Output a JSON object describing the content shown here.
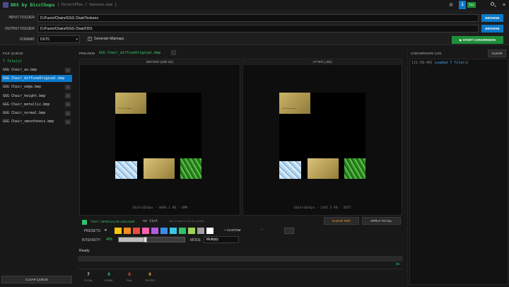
{
  "titlebar": {
    "app_title": "DDS by DiccChops",
    "subtitle": "[ DirectXTex / texconv.exe ]",
    "info_label": "i",
    "badge": "tex"
  },
  "form": {
    "input_label": "INPUT FOLDER",
    "input_value": "D:/Fuorn/Chairs/GGG Chair/Textures",
    "output_label": "OUTPUT FOLDER",
    "output_value": "D:/Fuorn/Chairs/GGG Chair/DDS",
    "format_label": "FORMAT",
    "format_value": "DXT5",
    "mipmaps_label": "Generate Mipmaps",
    "mipmaps_checked": true,
    "browse_label": "BROWSE",
    "start_label": "▶ START CONVERSION"
  },
  "queue": {
    "title": "FILE QUEUE",
    "count": "7 file(s)",
    "items": [
      {
        "name": "GGG Chair_ao.bmp"
      },
      {
        "name": "GGG Chair_diffuseOriginal.bmp"
      },
      {
        "name": "GGG Chair_edge.bmp"
      },
      {
        "name": "GGG Chair_height.bmp"
      },
      {
        "name": "GGG Chair_metallic.bmp"
      },
      {
        "name": "GGG Chair_normal.bmp"
      },
      {
        "name": "GGG Chair_smoothness.bmp"
      }
    ],
    "remove_glyph": "×",
    "clear_label": "CLEAR QUEUE"
  },
  "preview": {
    "label": "PREVIEW",
    "file": "GGG Chair_diffuseOriginal.bmp",
    "before_title": "BEFORE (with tint)",
    "after_title": "AFTER (.dds)",
    "before_info": "1024×1024px  ·  4096.1 KB  ·  BMP",
    "after_info": "1024×1024px  ·  1365.5 KB  ·  DXT5",
    "tile_caption": "GGG Chair Original"
  },
  "tint": {
    "title": "TINT / SPECULAR COLOUR",
    "no_tint": "no tint",
    "hint": "click a swatch to tint the preview",
    "clear_label": "CLEAR TINT",
    "apply_all_label": "APPLY TO ALL",
    "presets_label": "PRESETS",
    "preset_none": "✖",
    "swatches": [
      "#f5c518",
      "#f58a1e",
      "#e74c3c",
      "#ff5fb0",
      "#b05ce0",
      "#3b8de8",
      "#38c6e8",
      "#2fc26b",
      "#9ed25a",
      "#a0a0a0",
      "#ffffff"
    ],
    "custom_label": "+ CUSTOM",
    "dash": "—",
    "intensity_label": "INTENSITY",
    "intensity_value": "40%",
    "intensity": 0.4,
    "mode_label": "MODE",
    "mode_value": "Multiply",
    "pick_color": "#2d2d2d"
  },
  "status": {
    "text": "Ready",
    "progress_label": "0%",
    "progress": 0
  },
  "stats": [
    {
      "value": "7",
      "label": "TOTAL",
      "color": "#d8d8d8"
    },
    {
      "value": "0",
      "label": "DONE",
      "color": "#2fc26b"
    },
    {
      "value": "0",
      "label": "FAIL",
      "color": "#e74c3c"
    },
    {
      "value": "0",
      "label": "TINTED",
      "color": "#f5a623"
    }
  ],
  "log": {
    "title": "CONVERSION LOG",
    "clear_label": "CLEAR",
    "lines": [
      {
        "time": "[21:58:40]",
        "msg": "Loaded 7 file(s)"
      }
    ]
  },
  "colors": {
    "accent_blue": "#0a78c8",
    "accent_green": "#1f8f3a",
    "queue_selected": "#0a78c8"
  }
}
